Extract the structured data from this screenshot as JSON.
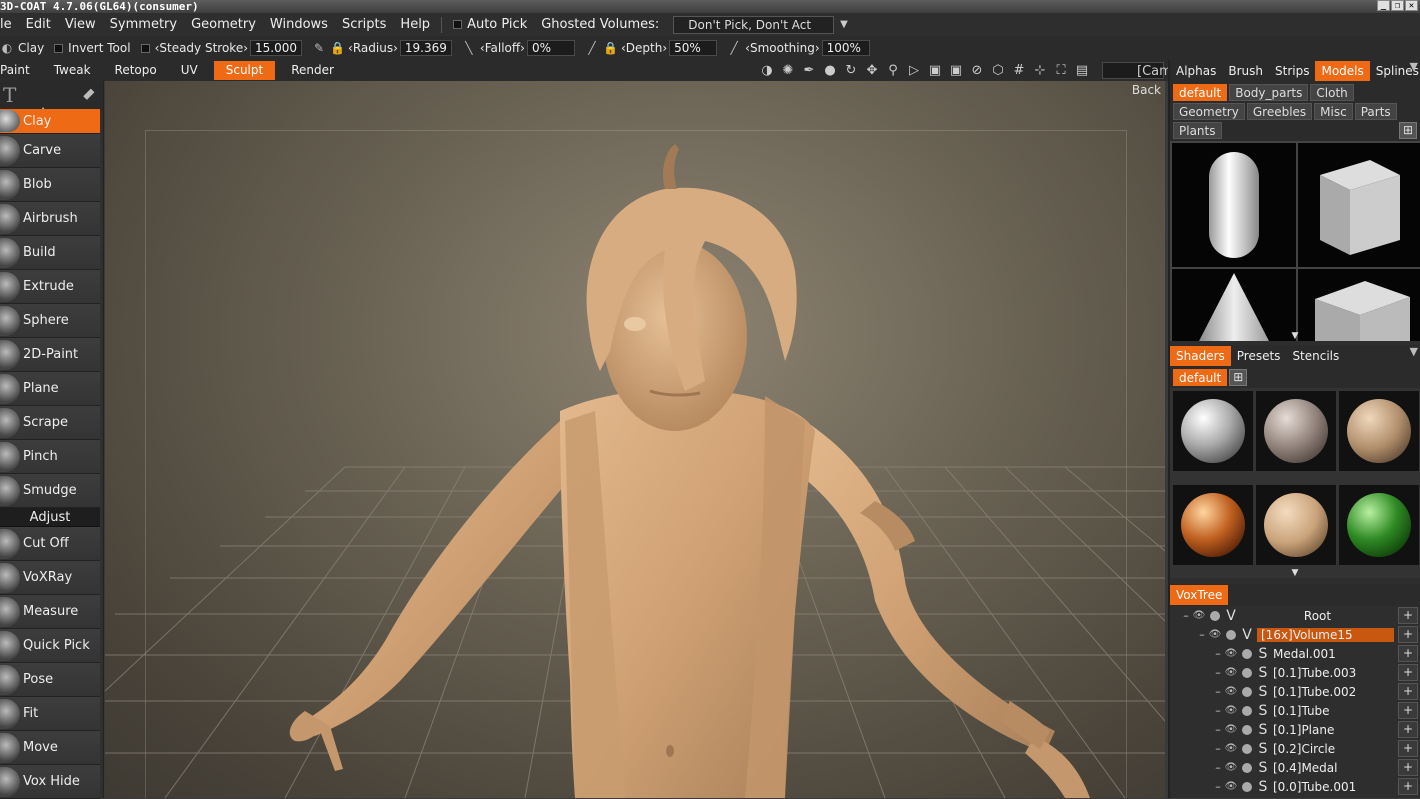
{
  "window": {
    "title": "3D-COAT 4.7.06(GL64)(consumer)"
  },
  "menu": {
    "items": [
      "le",
      "Edit",
      "View",
      "Symmetry",
      "Geometry",
      "Windows",
      "Scripts",
      "Help"
    ],
    "auto_pick": "Auto Pick",
    "ghosted_label": "Ghosted Volumes:",
    "ghosted_value": "Don't Pick, Don't Act"
  },
  "toolbar": {
    "tool_name": "Clay",
    "invert_tool": "Invert Tool",
    "steady_stroke": "Steady Stroke",
    "steady_value": "15.000",
    "radius_label": "Radius",
    "radius_value": "19.369",
    "falloff_label": "Falloff",
    "falloff_value": "0%",
    "depth_label": "Depth",
    "depth_value": "50%",
    "smoothing_label": "Smoothing",
    "smoothing_value": "100%"
  },
  "room_tabs": [
    {
      "label": "Paint",
      "active": false
    },
    {
      "label": "Tweak",
      "active": false
    },
    {
      "label": "Retopo",
      "active": false
    },
    {
      "label": "UV",
      "active": false
    },
    {
      "label": "Sculpt",
      "active": true
    },
    {
      "label": "Render",
      "active": false
    }
  ],
  "camera": "[Camera]",
  "viewport": {
    "back_label": "Back"
  },
  "tools": [
    {
      "label": "Clay",
      "active": true
    },
    {
      "label": "Carve"
    },
    {
      "label": "Blob"
    },
    {
      "label": "Airbrush"
    },
    {
      "label": "Build"
    },
    {
      "label": "Extrude"
    },
    {
      "label": "Sphere"
    },
    {
      "label": "2D-Paint"
    },
    {
      "label": "Plane"
    },
    {
      "label": "Scrape"
    },
    {
      "label": "Pinch"
    },
    {
      "label": "Smudge"
    }
  ],
  "adjust_label": "Adjust",
  "adjust_tools": [
    {
      "label": "Cut Off"
    },
    {
      "label": "VoXRay"
    },
    {
      "label": "Measure"
    },
    {
      "label": "Quick Pick"
    },
    {
      "label": "Pose"
    },
    {
      "label": "Fit"
    },
    {
      "label": "Move"
    },
    {
      "label": "Vox Hide"
    }
  ],
  "right": {
    "top_tabs": [
      {
        "label": "Alphas",
        "active": false
      },
      {
        "label": "Brush",
        "active": false
      },
      {
        "label": "Strips",
        "active": false
      },
      {
        "label": "Models",
        "active": true
      },
      {
        "label": "Splines",
        "active": false
      }
    ],
    "model_folders": [
      {
        "label": "default",
        "active": true
      },
      {
        "label": "Body_parts"
      },
      {
        "label": "Cloth"
      },
      {
        "label": "Geometry"
      },
      {
        "label": "Greebles"
      },
      {
        "label": "Misc"
      },
      {
        "label": "Parts"
      },
      {
        "label": "Plants"
      }
    ],
    "shader_tabs": [
      {
        "label": "Shaders",
        "active": true
      },
      {
        "label": "Presets"
      },
      {
        "label": "Stencils"
      }
    ],
    "shader_folder": "default",
    "voxtree_tab": "VoxTree",
    "voxtree": [
      {
        "indent": 0,
        "letter": "V",
        "name": "Root",
        "selected": false
      },
      {
        "indent": 1,
        "letter": "V",
        "name": "[16x]Volume15",
        "selected": true
      },
      {
        "indent": 2,
        "letter": "S",
        "name": "Medal.001"
      },
      {
        "indent": 2,
        "letter": "S",
        "name": "[0.1]Tube.003"
      },
      {
        "indent": 2,
        "letter": "S",
        "name": "[0.1]Tube.002"
      },
      {
        "indent": 2,
        "letter": "S",
        "name": "[0.1]Tube"
      },
      {
        "indent": 2,
        "letter": "S",
        "name": "[0.1]Plane"
      },
      {
        "indent": 2,
        "letter": "S",
        "name": "[0.2]Circle"
      },
      {
        "indent": 2,
        "letter": "S",
        "name": "[0.4]Medal"
      },
      {
        "indent": 2,
        "letter": "S",
        "name": "[0.0]Tube.001"
      }
    ]
  },
  "colors": {
    "accent": "#ef6a14",
    "skin": "#d2a67a"
  }
}
